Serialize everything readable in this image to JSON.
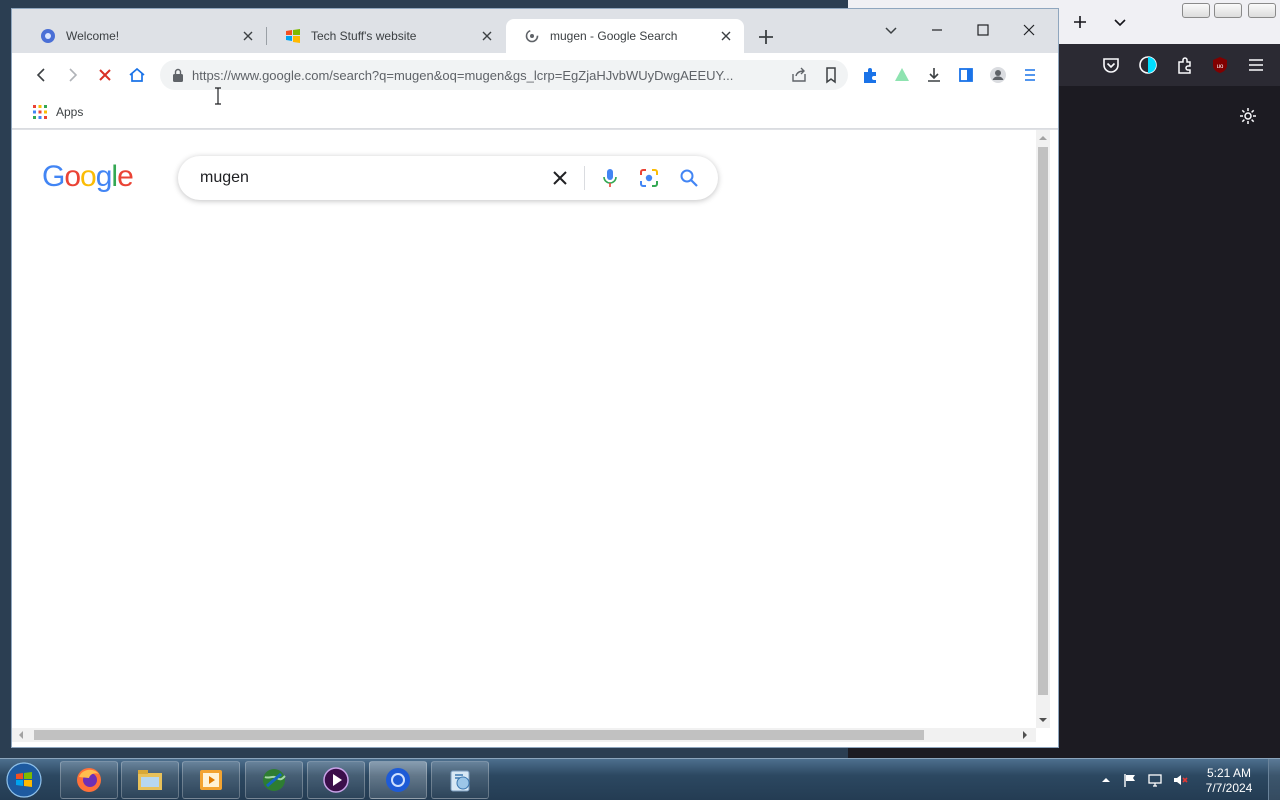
{
  "browser": {
    "tabs": [
      {
        "title": "Welcome!",
        "favicon": "chromium-icon",
        "active": false
      },
      {
        "title": "Tech Stuff's website",
        "favicon": "windows-flag-icon",
        "active": false
      },
      {
        "title": "mugen - Google Search",
        "favicon": "loading-icon",
        "active": true
      }
    ],
    "address_bar": {
      "url": "https://www.google.com/search?q=mugen&oq=mugen&gs_lcrp=EgZjaHJvbWUyDwgAEEUY..."
    },
    "bookmarks": {
      "apps_label": "Apps"
    }
  },
  "page": {
    "logo_letters": [
      "G",
      "o",
      "o",
      "g",
      "l",
      "e"
    ],
    "logo_colors": [
      "#4285f4",
      "#ea4335",
      "#fbbc05",
      "#4285f4",
      "#34a853",
      "#ea4335"
    ],
    "search_query": "mugen"
  },
  "taskbar": {
    "apps": [
      "firefox-icon",
      "file-explorer-icon",
      "media-player-icon",
      "network-globe-icon",
      "video-app-icon",
      "chrome-icon",
      "utility-icon"
    ],
    "clock": {
      "time": "5:21 AM",
      "date": "7/7/2024"
    }
  },
  "colors": {
    "accent_blue": "#1a73e8",
    "stop_red": "#d93025"
  }
}
